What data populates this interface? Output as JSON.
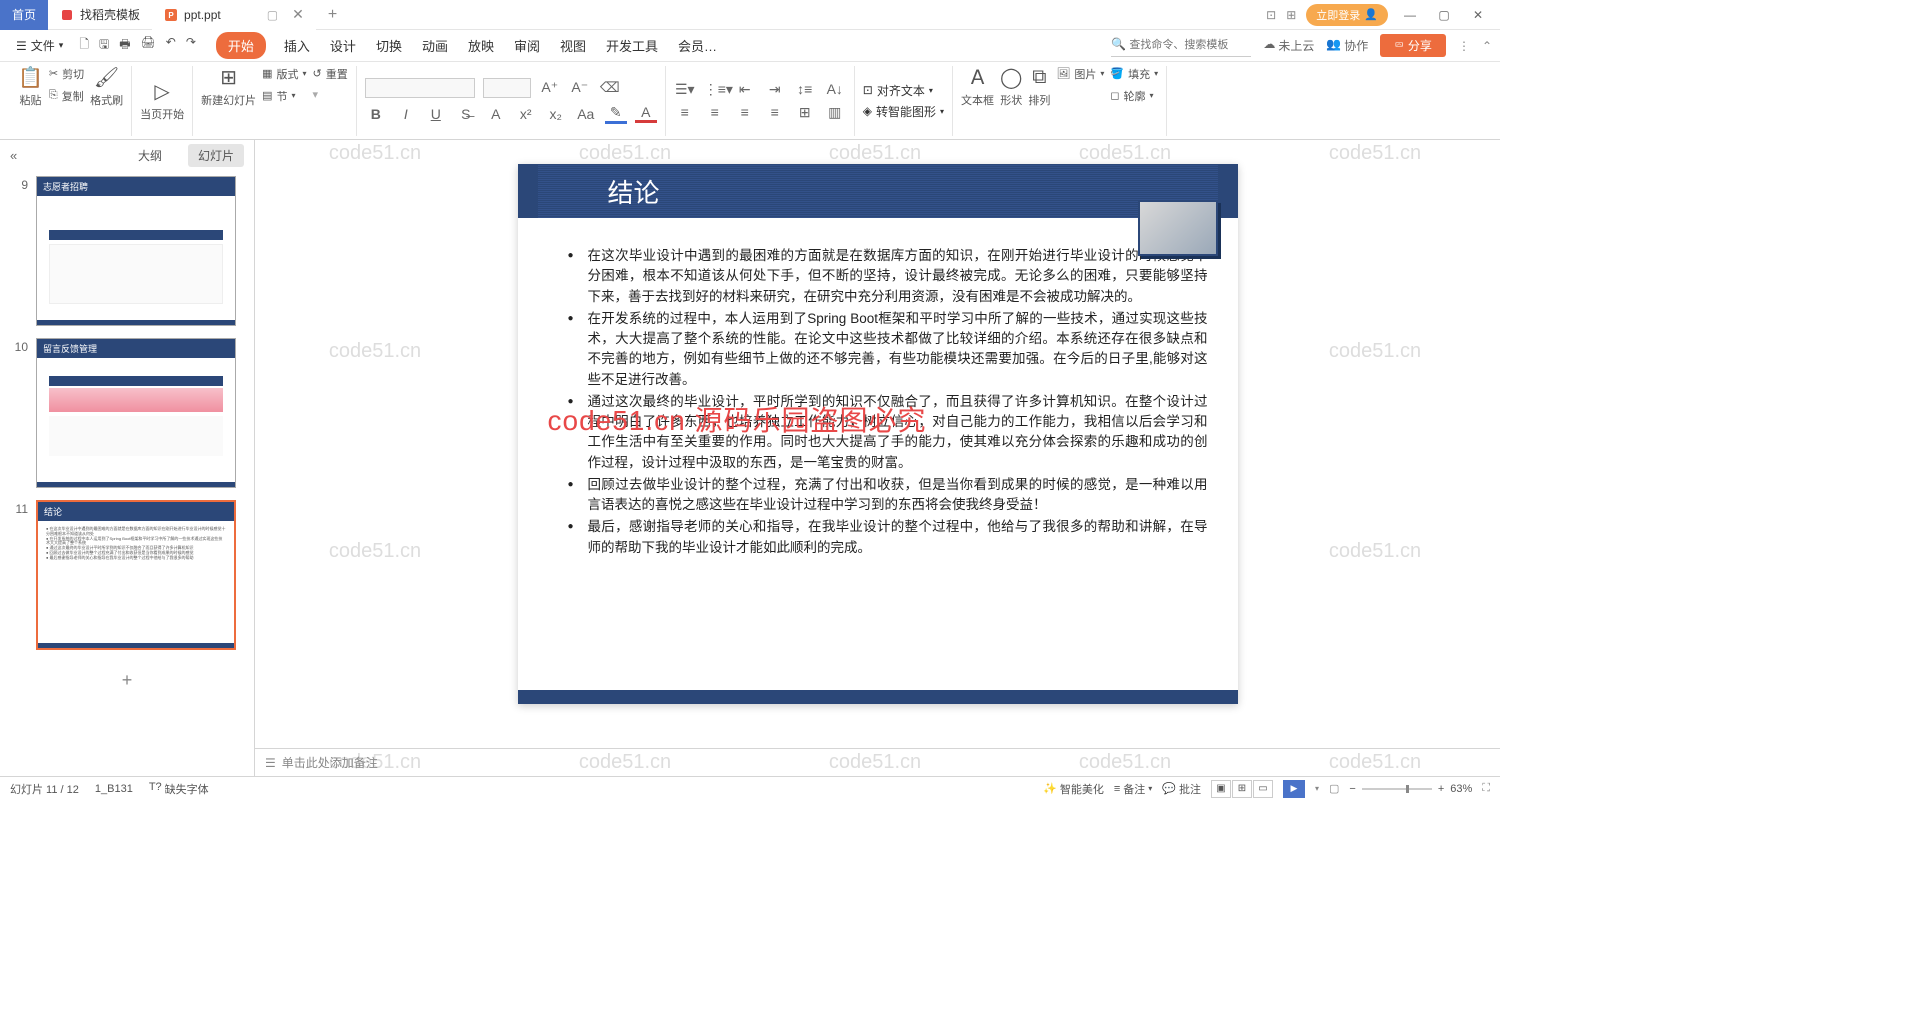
{
  "titlebar": {
    "home_tab": "首页",
    "template_tab": "找稻壳模板",
    "doc_tab": "ppt.ppt",
    "login": "立即登录"
  },
  "menubar": {
    "file": "文件",
    "tabs": [
      "开始",
      "插入",
      "设计",
      "切换",
      "动画",
      "放映",
      "审阅",
      "视图",
      "开发工具",
      "会员…"
    ],
    "search_placeholder": "查找命令、搜索模板",
    "cloud": "未上云",
    "collab": "协作",
    "share": "分享"
  },
  "ribbon": {
    "paste": "粘贴",
    "cut": "剪切",
    "copy": "复制",
    "format_painter": "格式刷",
    "from_current": "当页开始",
    "new_slide": "新建幻灯片",
    "layout": "版式",
    "section": "节",
    "reset": "重置",
    "align_text": "对齐文本",
    "smart_graphic": "转智能图形",
    "textbox": "文本框",
    "shape": "形状",
    "picture": "图片",
    "arrange": "排列",
    "fill": "填充",
    "outline": "轮廓"
  },
  "sidepanel": {
    "outline": "大纲",
    "slides": "幻灯片",
    "thumbs": [
      {
        "num": "9",
        "title": "志愿者招聘"
      },
      {
        "num": "10",
        "title": "留言反馈管理"
      },
      {
        "num": "11",
        "title": "结论"
      }
    ]
  },
  "slide": {
    "title": "结论",
    "bullets": [
      "在这次毕业设计中遇到的最困难的方面就是在数据库方面的知识，在刚开始进行毕业设计的时候感觉十分困难，根本不知道该从何处下手，但不断的坚持，设计最终被完成。无论多么的困难，只要能够坚持下来，善于去找到好的材料来研究，在研究中充分利用资源，没有困难是不会被成功解决的。",
      "在开发系统的过程中，本人运用到了Spring Boot框架和平时学习中所了解的一些技术，通过实现这些技术，大大提高了整个系统的性能。在论文中这些技术都做了比较详细的介绍。本系统还存在很多缺点和不完善的地方，例如有些细节上做的还不够完善，有些功能模块还需要加强。在今后的日子里,能够对这些不足进行改善。",
      "通过这次最终的毕业设计，平时所学到的知识不仅融合了，而且获得了许多计算机知识。在整个设计过程中明白了许多东西，也培养独立工作能力，树立信心，对自己能力的工作能力，我相信以后会学习和工作生活中有至关重要的作用。同时也大大提高了手的能力，使其难以充分体会探索的乐趣和成功的创作过程，设计过程中汲取的东西，是一笔宝贵的财富。",
      "回顾过去做毕业设计的整个过程，充满了付出和收获，但是当你看到成果的时候的感觉，是一种难以用言语表达的喜悦之感这些在毕业设计过程中学习到的东西将会使我终身受益！",
      "最后，感谢指导老师的关心和指导，在我毕业设计的整个过程中，他给与了我很多的帮助和讲解，在导师的帮助下我的毕业设计才能如此顺利的完成。"
    ],
    "overlay": "code51.cn 源码乐园盗图必究"
  },
  "notes": {
    "placeholder": "单击此处添加备注"
  },
  "statusbar": {
    "slide_pos": "幻灯片 11 / 12",
    "item2": "1_B131",
    "missing_font": "缺失字体",
    "smart_beautify": "智能美化",
    "notes_btn": "备注",
    "comments_btn": "批注",
    "zoom": "63%"
  },
  "watermark": "code51.cn"
}
